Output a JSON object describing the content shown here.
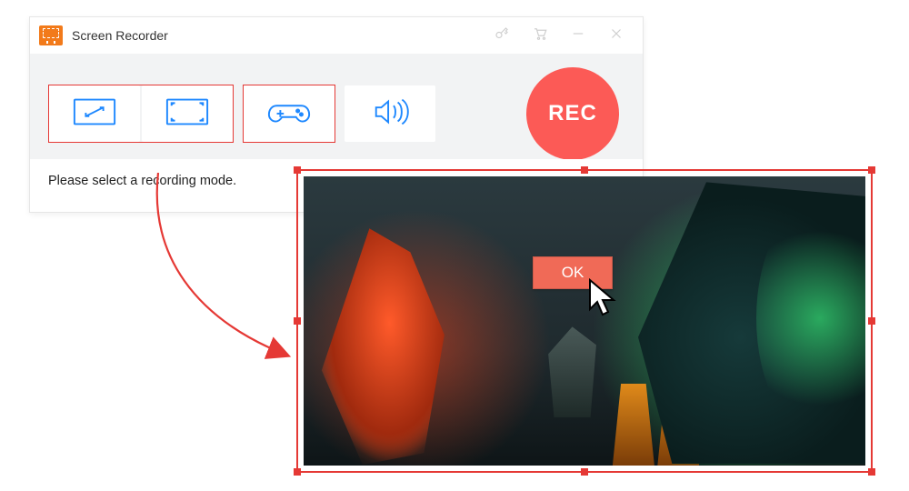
{
  "window": {
    "title": "Screen Recorder"
  },
  "toolbar": {
    "rec_label": "REC"
  },
  "footer": {
    "prompt": "Please select a recording mode."
  },
  "selection": {
    "ok_label": "OK"
  },
  "icons": {
    "logo": "screen-recorder-logo",
    "key": "key-icon",
    "cart": "cart-icon",
    "minimize": "minimize-icon",
    "close": "close-icon",
    "region": "region-select-icon",
    "fullscreen": "fullscreen-icon",
    "game": "gamepad-icon",
    "audio": "speaker-icon",
    "chevron": "chevron-down-icon",
    "cursor": "mouse-cursor-icon"
  },
  "colors": {
    "brand_orange": "#f27a1a",
    "accent_blue": "#1e88ff",
    "rec_red": "#fc5a56",
    "select_red": "#e53935",
    "ok_bg": "#f06a57"
  }
}
